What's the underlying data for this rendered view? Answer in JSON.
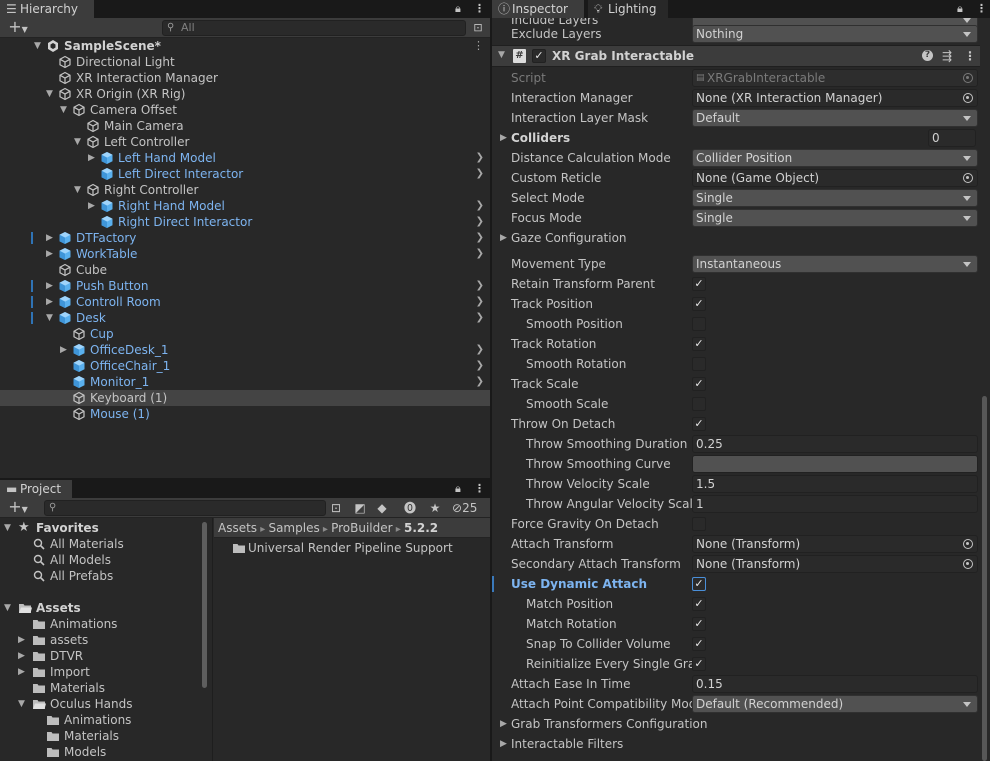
{
  "hierarchy": {
    "tab": "Hierarchy",
    "add_label": "+",
    "search_placeholder": "All",
    "rows": [
      {
        "label": "SampleScene*",
        "depth": 0,
        "arrow": "down",
        "icon": "unity-scene-icon",
        "type": "scene"
      },
      {
        "label": "Directional Light",
        "depth": 1,
        "arrow": "",
        "icon": "gameobject-icon",
        "type": "go"
      },
      {
        "label": "XR Interaction Manager",
        "depth": 1,
        "arrow": "",
        "icon": "gameobject-icon",
        "type": "go"
      },
      {
        "label": "XR Origin (XR Rig)",
        "depth": 1,
        "arrow": "down",
        "icon": "gameobject-icon",
        "type": "go"
      },
      {
        "label": "Camera Offset",
        "depth": 2,
        "arrow": "down",
        "icon": "gameobject-icon",
        "type": "go"
      },
      {
        "label": "Main Camera",
        "depth": 3,
        "arrow": "",
        "icon": "gameobject-icon",
        "type": "go"
      },
      {
        "label": "Left Controller",
        "depth": 3,
        "arrow": "down",
        "icon": "gameobject-icon",
        "type": "go"
      },
      {
        "label": "Left Hand Model",
        "depth": 4,
        "arrow": "right",
        "icon": "prefab-icon",
        "type": "prefab",
        "chev": true
      },
      {
        "label": "Left Direct Interactor",
        "depth": 4,
        "arrow": "",
        "icon": "prefab-icon",
        "type": "prefab",
        "chev": true
      },
      {
        "label": "Right Controller",
        "depth": 3,
        "arrow": "down",
        "icon": "gameobject-icon",
        "type": "go"
      },
      {
        "label": "Right Hand Model",
        "depth": 4,
        "arrow": "right",
        "icon": "prefab-icon",
        "type": "prefab",
        "chev": true
      },
      {
        "label": "Right Direct Interactor",
        "depth": 4,
        "arrow": "",
        "icon": "prefab-icon",
        "type": "prefab",
        "chev": true
      },
      {
        "label": "DTFactory",
        "depth": 1,
        "arrow": "right",
        "icon": "prefab-icon",
        "type": "prefab",
        "chev": true,
        "mark": true
      },
      {
        "label": "WorkTable",
        "depth": 1,
        "arrow": "right",
        "icon": "prefab-icon",
        "type": "prefab",
        "chev": true
      },
      {
        "label": "Cube",
        "depth": 1,
        "arrow": "",
        "icon": "gameobject-icon",
        "type": "go"
      },
      {
        "label": "Push Button",
        "depth": 1,
        "arrow": "right",
        "icon": "prefab-icon",
        "type": "prefab",
        "chev": true,
        "mark": true
      },
      {
        "label": "Controll Room",
        "depth": 1,
        "arrow": "right",
        "icon": "prefab-icon",
        "type": "prefab",
        "chev": true,
        "mark": true
      },
      {
        "label": "Desk",
        "depth": 1,
        "arrow": "down",
        "icon": "prefab-icon",
        "type": "prefab",
        "chev": true,
        "mark": true
      },
      {
        "label": "Cup",
        "depth": 2,
        "arrow": "",
        "icon": "gameobject-icon",
        "type": "prefabchild"
      },
      {
        "label": "OfficeDesk_1",
        "depth": 2,
        "arrow": "right",
        "icon": "prefab-icon",
        "type": "prefab",
        "chev": true
      },
      {
        "label": "OfficeChair_1",
        "depth": 2,
        "arrow": "",
        "icon": "prefab-icon",
        "type": "prefab",
        "chev": true
      },
      {
        "label": "Monitor_1",
        "depth": 2,
        "arrow": "",
        "icon": "prefab-icon",
        "type": "prefab",
        "chev": true
      },
      {
        "label": "Keyboard (1)",
        "depth": 2,
        "arrow": "",
        "icon": "gameobject-icon",
        "type": "go",
        "selected": true
      },
      {
        "label": "Mouse (1)",
        "depth": 2,
        "arrow": "",
        "icon": "gameobject-icon",
        "type": "prefabchild"
      }
    ]
  },
  "project": {
    "tab": "Project",
    "add_label": "+",
    "hidden_count": "25",
    "tree": [
      {
        "label": "Favorites",
        "depth": 0,
        "arrow": "down",
        "icon": "star-icon",
        "bold": true
      },
      {
        "label": "All Materials",
        "depth": 1,
        "arrow": "",
        "icon": "search-icon"
      },
      {
        "label": "All Models",
        "depth": 1,
        "arrow": "",
        "icon": "search-icon"
      },
      {
        "label": "All Prefabs",
        "depth": 1,
        "arrow": "",
        "icon": "search-icon"
      },
      {
        "label": "",
        "depth": 0,
        "arrow": "",
        "icon": ""
      },
      {
        "label": "Assets",
        "depth": 0,
        "arrow": "down",
        "icon": "folder-open-icon",
        "bold": true
      },
      {
        "label": "Animations",
        "depth": 1,
        "arrow": "",
        "icon": "folder-icon"
      },
      {
        "label": "assets",
        "depth": 1,
        "arrow": "right",
        "icon": "folder-icon"
      },
      {
        "label": "DTVR",
        "depth": 1,
        "arrow": "right",
        "icon": "folder-icon"
      },
      {
        "label": "Import",
        "depth": 1,
        "arrow": "right",
        "icon": "folder-icon"
      },
      {
        "label": "Materials",
        "depth": 1,
        "arrow": "",
        "icon": "folder-icon"
      },
      {
        "label": "Oculus Hands",
        "depth": 1,
        "arrow": "down",
        "icon": "folder-open-icon"
      },
      {
        "label": "Animations",
        "depth": 2,
        "arrow": "",
        "icon": "folder-icon"
      },
      {
        "label": "Materials",
        "depth": 2,
        "arrow": "",
        "icon": "folder-icon"
      },
      {
        "label": "Models",
        "depth": 2,
        "arrow": "",
        "icon": "folder-icon"
      }
    ],
    "breadcrumb": [
      "Assets",
      "Samples",
      "ProBuilder",
      "5.2.2"
    ],
    "files": [
      {
        "label": "Universal Render Pipeline Support",
        "icon": "folder-icon"
      }
    ]
  },
  "inspector": {
    "tab": "Inspector",
    "tab2": "Lighting",
    "component_title": "XR Grab Interactable",
    "partial_top": "Include Layers",
    "rows": [
      {
        "label": "Exclude Layers",
        "kind": "dd",
        "value": "Nothing"
      },
      {
        "kind": "component"
      },
      {
        "label": "Script",
        "kind": "script",
        "value": "XRGrabInteractable",
        "dim": true
      },
      {
        "label": "Interaction Manager",
        "kind": "obj",
        "value": "None (XR Interaction Manager)"
      },
      {
        "label": "Interaction Layer Mask",
        "kind": "dd",
        "value": "Default"
      },
      {
        "label": "Colliders",
        "kind": "small",
        "value": "0",
        "fold": true,
        "bold": true
      },
      {
        "label": "Distance Calculation Mode",
        "kind": "dd",
        "value": "Collider Position"
      },
      {
        "label": "Custom Reticle",
        "kind": "obj",
        "value": "None (Game Object)"
      },
      {
        "label": "Select Mode",
        "kind": "dd",
        "value": "Single"
      },
      {
        "label": "Focus Mode",
        "kind": "dd",
        "value": "Single"
      },
      {
        "label": "Gaze Configuration",
        "kind": "fold",
        "fold": true
      },
      {
        "kind": "gap"
      },
      {
        "label": "Movement Type",
        "kind": "dd",
        "value": "Instantaneous"
      },
      {
        "label": "Retain Transform Parent",
        "kind": "chk",
        "value": "✓"
      },
      {
        "label": "Track Position",
        "kind": "chk",
        "value": "✓"
      },
      {
        "label": "Smooth Position",
        "kind": "chk",
        "value": "",
        "indent": true
      },
      {
        "label": "Track Rotation",
        "kind": "chk",
        "value": "✓"
      },
      {
        "label": "Smooth Rotation",
        "kind": "chk",
        "value": "",
        "indent": true
      },
      {
        "label": "Track Scale",
        "kind": "chk",
        "value": "✓"
      },
      {
        "label": "Smooth Scale",
        "kind": "chk",
        "value": "",
        "indent": true
      },
      {
        "label": "Throw On Detach",
        "kind": "chk",
        "value": "✓"
      },
      {
        "label": "Throw Smoothing Duration",
        "kind": "num",
        "value": "0.25",
        "indent": true
      },
      {
        "label": "Throw Smoothing Curve",
        "kind": "curve",
        "value": "",
        "indent": true
      },
      {
        "label": "Throw Velocity Scale",
        "kind": "num",
        "value": "1.5",
        "indent": true
      },
      {
        "label": "Throw Angular Velocity Scale",
        "kind": "num",
        "value": "1",
        "indent": true
      },
      {
        "label": "Force Gravity On Detach",
        "kind": "chk",
        "value": ""
      },
      {
        "label": "Attach Transform",
        "kind": "obj",
        "value": "None (Transform)"
      },
      {
        "label": "Secondary Attach Transform",
        "kind": "obj",
        "value": "None (Transform)"
      },
      {
        "label": "Use Dynamic Attach",
        "kind": "chk",
        "value": "✓",
        "blue": true
      },
      {
        "label": "Match Position",
        "kind": "chk",
        "value": "✓",
        "indent": true
      },
      {
        "label": "Match Rotation",
        "kind": "chk",
        "value": "✓",
        "indent": true
      },
      {
        "label": "Snap To Collider Volume",
        "kind": "chk",
        "value": "✓",
        "indent": true
      },
      {
        "label": "Reinitialize Every Single Grab",
        "kind": "chk",
        "value": "✓",
        "indent": true
      },
      {
        "label": "Attach Ease In Time",
        "kind": "num",
        "value": "0.15"
      },
      {
        "label": "Attach Point Compatibility Mode",
        "kind": "dd",
        "value": "Default (Recommended)"
      },
      {
        "label": "Grab Transformers Configuration",
        "kind": "fold",
        "fold": true
      },
      {
        "label": "Interactable Filters",
        "kind": "fold",
        "fold": true
      }
    ]
  }
}
